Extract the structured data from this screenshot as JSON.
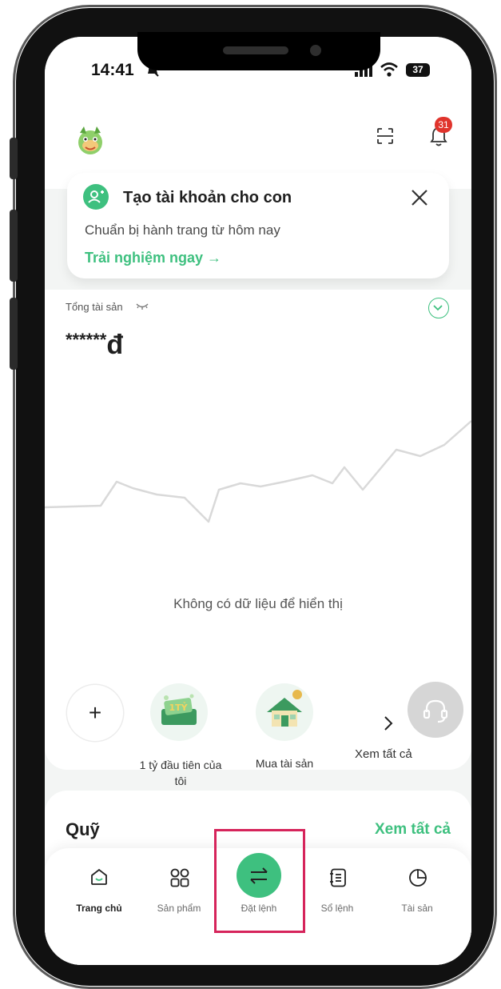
{
  "status_bar": {
    "time": "14:41",
    "battery": "37"
  },
  "notification": {
    "badge_count": "31"
  },
  "promo": {
    "title": "Tạo tài khoản cho con",
    "subtitle": "Chuẩn bị hành trang từ hôm nay",
    "link": "Trải nghiệm ngay →"
  },
  "assets": {
    "label": "Tổng tài sản",
    "value_masked": "******",
    "currency": "đ",
    "empty_message": "Không có dữ liệu để hiển thị"
  },
  "goals": {
    "add_label": "+",
    "items": [
      {
        "label_line1": "1 tỷ đầu tiên của",
        "label_line2": "tôi",
        "icon": "money-1ty-icon"
      },
      {
        "label_line1": "Mua tài sản",
        "label_line2": "",
        "icon": "house-icon"
      }
    ],
    "see_all": "Xem tất cả"
  },
  "fund": {
    "title": "Quỹ",
    "see_all": "Xem tất cả"
  },
  "nav": [
    {
      "label": "Trang chủ",
      "icon": "home-icon",
      "active": true
    },
    {
      "label": "Sản phẩm",
      "icon": "grid-icon",
      "active": false
    },
    {
      "label": "Đặt lệnh",
      "icon": "swap-icon",
      "active": false
    },
    {
      "label": "Sổ lệnh",
      "icon": "ledger-icon",
      "active": false
    },
    {
      "label": "Tài sản",
      "icon": "pie-chart-icon",
      "active": false
    }
  ],
  "colors": {
    "accent": "#3ec07f",
    "highlight": "#d6245b",
    "badge": "#e0342c"
  }
}
